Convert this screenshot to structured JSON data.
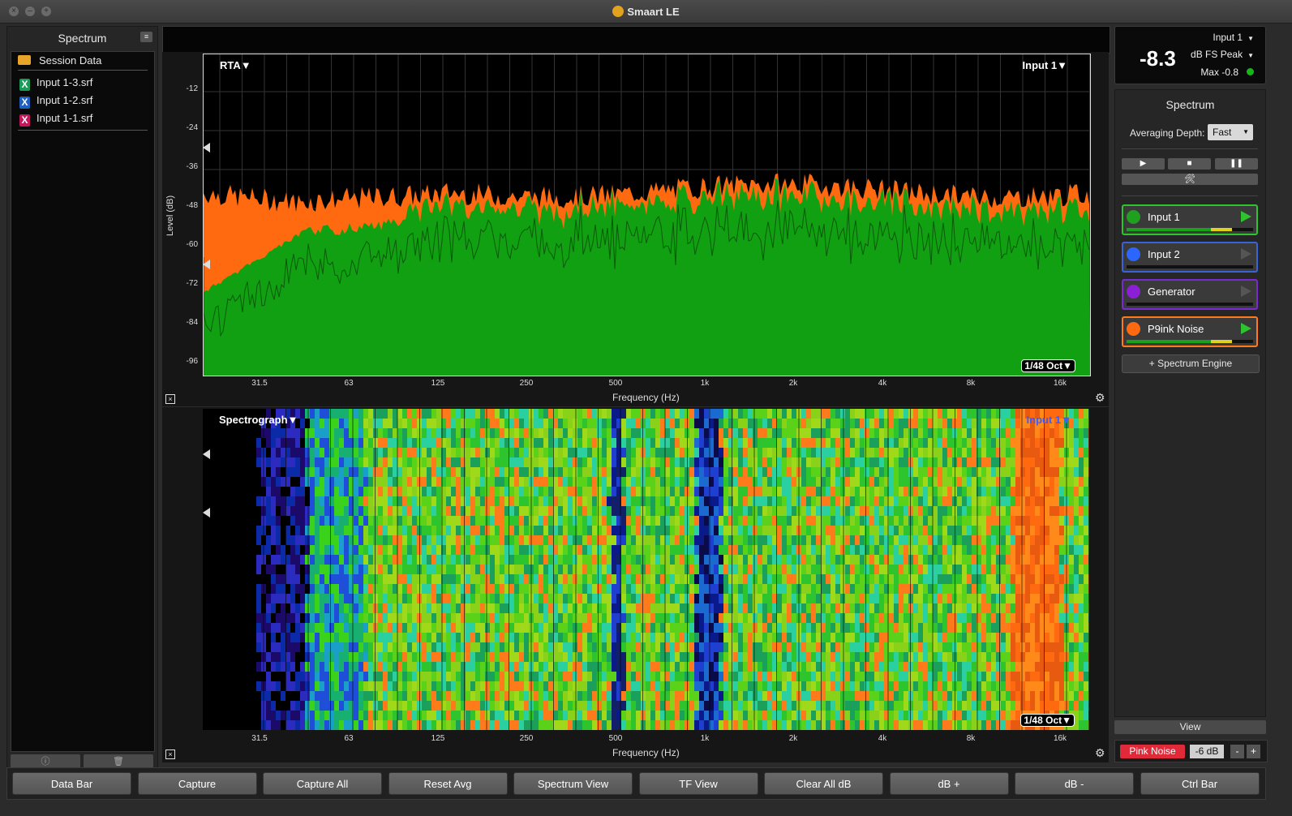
{
  "window": {
    "title": "Smaart LE"
  },
  "left_panel": {
    "title": "Spectrum",
    "session_label": "Session Data",
    "files": [
      {
        "name": "Input 1-3.srf",
        "color": "#1a9b5a"
      },
      {
        "name": "Input 1-2.srf",
        "color": "#1f5fbf"
      },
      {
        "name": "Input 1-1.srf",
        "color": "#c2185b"
      }
    ],
    "footer": {
      "info_icon": "ⓘ",
      "trash_icon": "🗑"
    }
  },
  "rta_plot": {
    "mode_label": "RTA▼",
    "input_label": "Input 1▼",
    "resolution": "1/48 Oct▼",
    "ylabel": "Level (dB)",
    "xlabel": "Frequency (Hz)",
    "yticks": [
      "-12",
      "-24",
      "-36",
      "-48",
      "-60",
      "-72",
      "-84",
      "-96"
    ],
    "xticks": [
      "31.5",
      "63",
      "125",
      "250",
      "500",
      "1k",
      "2k",
      "4k",
      "8k",
      "16k"
    ]
  },
  "spectrograph_plot": {
    "mode_label": "Spectrograph▼",
    "input_label": "Input 1▼",
    "resolution": "1/48 Oct▼",
    "xlabel": "Frequency (Hz)",
    "xticks": [
      "31.5",
      "63",
      "125",
      "250",
      "500",
      "1k",
      "2k",
      "4k",
      "8k",
      "16k"
    ]
  },
  "meter": {
    "input": "Input 1",
    "value": "-8.3",
    "unit": "dB FS Peak",
    "max": "Max -0.8"
  },
  "spectrum_panel": {
    "title": "Spectrum",
    "avg_label": "Averaging Depth:",
    "avg_value": "Fast",
    "transport": {
      "play": "▶",
      "stop": "■",
      "pause": "❚❚",
      "tools": "🛠"
    },
    "engines": [
      {
        "name": "Input 1",
        "color": "#1fa01f",
        "border": "#2ec42e",
        "play_color": "#2ec42e",
        "level": 0.79
      },
      {
        "name": "Input 2",
        "color": "#2b66ff",
        "border": "#3a63d6",
        "play_color": "#555555",
        "level": 0
      },
      {
        "name": "Generator",
        "color": "#8a1fd6",
        "border": "#7a2bd0",
        "play_color": "#555555",
        "level": 0
      },
      {
        "name": "P9ink Noise",
        "color": "#ff6a10",
        "border": "#ff7a1a",
        "play_color": "#2ec42e",
        "level": 0.79
      }
    ],
    "add_engine": "+ Spectrum Engine"
  },
  "view_button": "View",
  "generator": {
    "label": "Pink Noise",
    "level": "-6 dB",
    "minus": "-",
    "plus": "+"
  },
  "bottom_bar": [
    "Data Bar",
    "Capture",
    "Capture All",
    "Reset Avg",
    "Spectrum View",
    "TF View",
    "Clear All dB",
    "dB +",
    "dB -",
    "Ctrl Bar"
  ]
}
